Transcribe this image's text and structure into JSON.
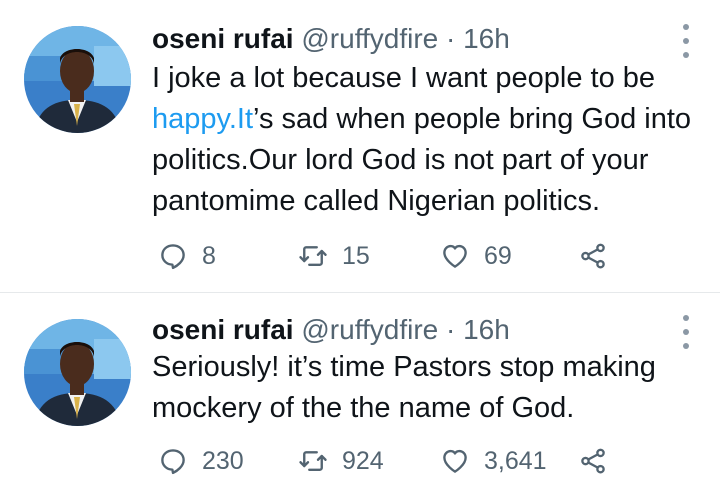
{
  "tweets": [
    {
      "author": {
        "name": "oseni rufai",
        "handle": "@ruffydfire"
      },
      "separator": "·",
      "time": "16h",
      "text_parts": [
        "I joke a lot because I want people to be ",
        "happy.It",
        "’s sad when people bring God into politics.Our lord God is not part of your pantomime called Nigerian politics."
      ],
      "actions": {
        "replies": "8",
        "retweets": "15",
        "likes": "69"
      }
    },
    {
      "author": {
        "name": "oseni rufai",
        "handle": "@ruffydfire"
      },
      "separator": "·",
      "time": "16h",
      "text": "Seriously! it’s time Pastors stop making mockery of the the name of God.",
      "actions": {
        "replies": "230",
        "retweets": "924",
        "likes": "3,641"
      }
    }
  ],
  "icons": {
    "reply": "reply-icon",
    "retweet": "retweet-icon",
    "like": "heart-icon",
    "share": "share-icon",
    "more": "more-options-icon"
  },
  "colors": {
    "link": "#1d9bf0",
    "muted": "#536471",
    "text": "#0f1419"
  }
}
